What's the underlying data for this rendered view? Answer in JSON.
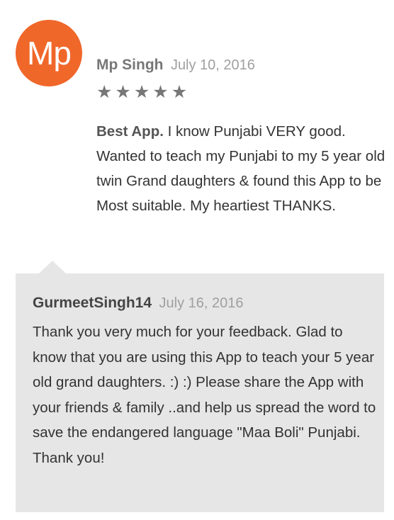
{
  "review": {
    "avatar_initials": "Mp",
    "avatar_color": "#f0672a",
    "author": "Mp Singh",
    "date": "July 10, 2016",
    "rating": 5,
    "rating_max": 5,
    "title": "Best App.",
    "text": " I know Punjabi VERY good. Wanted to teach my Punjabi to my 5 year old twin Grand daughters & found this App to be Most suitable. My heartiest THANKS."
  },
  "reply": {
    "author": "GurmeetSingh14",
    "date": "July 16, 2016",
    "text": "Thank you very much for your feedback. Glad to know that you are using this App to teach your 5 year old grand daughters. :) :) Please share the App with your friends & family ..and help us spread the word to save the endangered language \"Maa Boli\" Punjabi. Thank you!"
  }
}
